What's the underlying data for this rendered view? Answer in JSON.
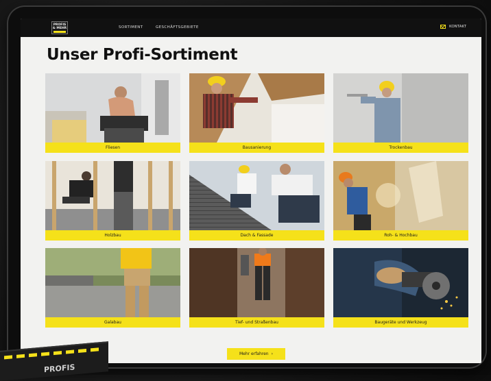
{
  "navbar": {
    "logo_line1": "PROFIS",
    "logo_line2": "& MEHR",
    "links": [
      "SORTIMENT",
      "GESCHÄFTSGEBIETE"
    ],
    "contact_label": "KONTAKT"
  },
  "page_title": "Unser Profi-Sortiment",
  "categories": [
    {
      "label": "Fliesen"
    },
    {
      "label": "Bausanierung"
    },
    {
      "label": "Trockenbau"
    },
    {
      "label": "Holzbau"
    },
    {
      "label": "Dach & Fassade"
    },
    {
      "label": "Roh- & Hochbau"
    },
    {
      "label": "Galabau"
    },
    {
      "label": "Tief- und Straßenbau"
    },
    {
      "label": "Baugeräte und Werkzeug"
    }
  ],
  "cta": {
    "label": "Mehr erfahren",
    "icon": "chevron-right-icon"
  },
  "box_text": "PROFIS",
  "colors": {
    "accent": "#f5e11a",
    "navbar": "#111111",
    "background": "#f2f2f0"
  }
}
